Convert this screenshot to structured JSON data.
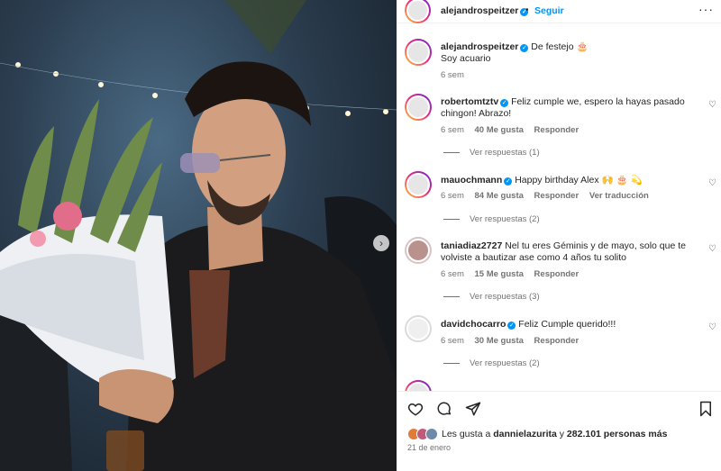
{
  "header": {
    "username": "alejandrospeitzer",
    "dot": "•",
    "follow_label": "Seguir",
    "more_icon": "more-icon"
  },
  "caption": {
    "username": "alejandrospeitzer",
    "text_line1": "De festejo 🎂",
    "text_line2": "Soy acuario",
    "time": "6 sem"
  },
  "comments": [
    {
      "username": "robertomtztv",
      "verified": true,
      "text": "Feliz cumple we, espero la hayas pasado chingon! Abrazo!",
      "time": "6 sem",
      "likes": "40 Me gusta",
      "reply": "Responder",
      "translate": "",
      "replies": "Ver respuestas (1)"
    },
    {
      "username": "mauochmann",
      "verified": true,
      "text": "Happy birthday Alex 🙌 🎂 💫",
      "time": "6 sem",
      "likes": "84 Me gusta",
      "reply": "Responder",
      "translate": "Ver traducción",
      "replies": "Ver respuestas (2)"
    },
    {
      "username": "taniadiaz2727",
      "verified": false,
      "text": "Nel tu eres Géminis y de mayo, solo que te volviste a bautizar ase como 4 años tu solito",
      "time": "6 sem",
      "likes": "15 Me gusta",
      "reply": "Responder",
      "translate": "",
      "replies": "Ver respuestas (3)"
    },
    {
      "username": "davidchocarro",
      "verified": true,
      "text": "Feliz Cumple querido!!!",
      "time": "6 sem",
      "likes": "30 Me gusta",
      "reply": "Responder",
      "translate": "",
      "replies": "Ver respuestas (2)"
    }
  ],
  "footer": {
    "likes_prefix": "Les gusta a",
    "likes_user": "dannielazurita",
    "likes_middle": "y",
    "likes_count": "282.101 personas más",
    "date": "21 de enero"
  },
  "icons": {
    "like": "heart-icon",
    "comment": "comment-icon",
    "share": "share-icon",
    "save": "bookmark-icon",
    "next": "chevron-right-icon"
  },
  "colors": {
    "accent": "#0095f6",
    "text": "#262626",
    "muted": "#737373"
  }
}
